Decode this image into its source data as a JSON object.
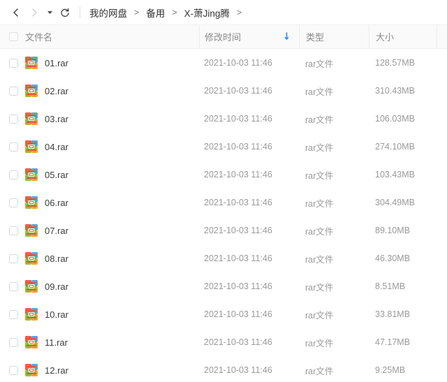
{
  "toolbar": {
    "back_icon": "chevron-left-icon",
    "forward_icon": "chevron-right-icon",
    "history_icon": "caret-down-icon",
    "refresh_icon": "refresh-icon",
    "breadcrumb": {
      "items": [
        "我的网盘",
        "备用",
        "X-萧Jing腾"
      ],
      "separator": ">",
      "trailing_separator": ">"
    }
  },
  "columns": {
    "name": "文件名",
    "modified": "修改时间",
    "type": "类型",
    "size": "大小",
    "sort_icon": "sort-descending-arrow-icon",
    "sort_color": "#2c8cf0",
    "select_all_checkbox": "unchecked"
  },
  "files": [
    {
      "name": "01.rar",
      "modified": "2021-10-03 11:46",
      "type": "rar文件",
      "size": "128.57MB",
      "icon": "rar-archive-icon",
      "checked": false
    },
    {
      "name": "02.rar",
      "modified": "2021-10-03 11:46",
      "type": "rar文件",
      "size": "310.43MB",
      "icon": "rar-archive-icon",
      "checked": false
    },
    {
      "name": "03.rar",
      "modified": "2021-10-03 11:46",
      "type": "rar文件",
      "size": "106.03MB",
      "icon": "rar-archive-icon",
      "checked": false
    },
    {
      "name": "04.rar",
      "modified": "2021-10-03 11:46",
      "type": "rar文件",
      "size": "274.10MB",
      "icon": "rar-archive-icon",
      "checked": false
    },
    {
      "name": "05.rar",
      "modified": "2021-10-03 11:46",
      "type": "rar文件",
      "size": "103.43MB",
      "icon": "rar-archive-icon",
      "checked": false
    },
    {
      "name": "06.rar",
      "modified": "2021-10-03 11:46",
      "type": "rar文件",
      "size": "304.49MB",
      "icon": "rar-archive-icon",
      "checked": false
    },
    {
      "name": "07.rar",
      "modified": "2021-10-03 11:46",
      "type": "rar文件",
      "size": "89.10MB",
      "icon": "rar-archive-icon",
      "checked": false
    },
    {
      "name": "08.rar",
      "modified": "2021-10-03 11:46",
      "type": "rar文件",
      "size": "46.30MB",
      "icon": "rar-archive-icon",
      "checked": false
    },
    {
      "name": "09.rar",
      "modified": "2021-10-03 11:46",
      "type": "rar文件",
      "size": "8.51MB",
      "icon": "rar-archive-icon",
      "checked": false
    },
    {
      "name": "10.rar",
      "modified": "2021-10-03 11:46",
      "type": "rar文件",
      "size": "33.81MB",
      "icon": "rar-archive-icon",
      "checked": false
    },
    {
      "name": "11.rar",
      "modified": "2021-10-03 11:46",
      "type": "rar文件",
      "size": "47.17MB",
      "icon": "rar-archive-icon",
      "checked": false
    },
    {
      "name": "12.rar",
      "modified": "2021-10-03 11:46",
      "type": "rar文件",
      "size": "9.25MB",
      "icon": "rar-archive-icon",
      "checked": false
    }
  ],
  "theme": {
    "accent": "#2c8cf0",
    "header_bg": "#fafafa",
    "text_primary": "#3d3d3d",
    "text_muted": "#9a9a9a",
    "divider": "#ececec"
  }
}
